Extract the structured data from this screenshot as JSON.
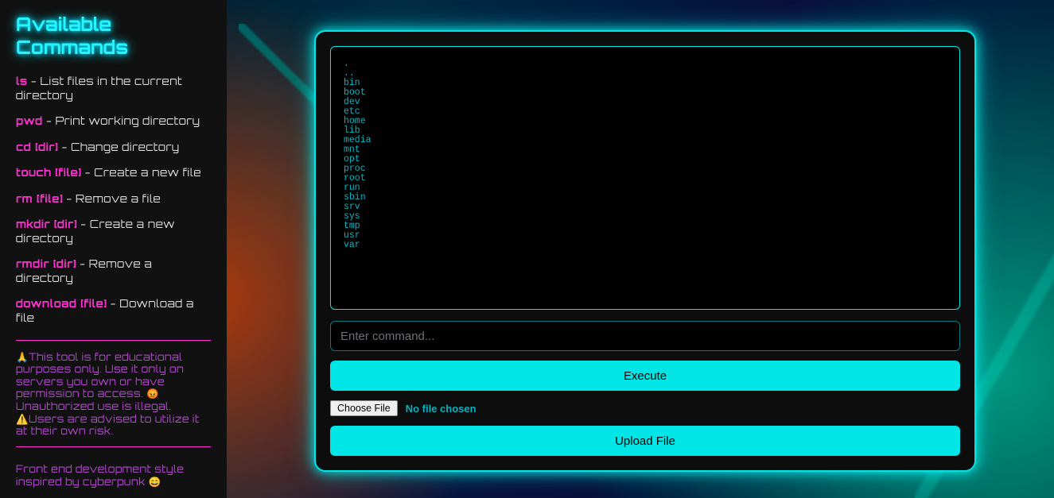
{
  "sidebar": {
    "title": "Available Commands",
    "commands": [
      {
        "cmd": "ls",
        "desc": " - List files in the current directory"
      },
      {
        "cmd": "pwd",
        "desc": " - Print working directory"
      },
      {
        "cmd": "cd [dir]",
        "desc": " - Change directory"
      },
      {
        "cmd": "touch [file]",
        "desc": " - Create a new file"
      },
      {
        "cmd": "rm [file]",
        "desc": " - Remove a file"
      },
      {
        "cmd": "mkdir [dir]",
        "desc": " - Create a new directory"
      },
      {
        "cmd": "rmdir [dir]",
        "desc": " - Remove a directory"
      },
      {
        "cmd": "download [file]",
        "desc": " - Download a file"
      }
    ],
    "disclaimer": "🙏This tool is for educational purposes only. Use it only on servers you own or have permission to access. 😡Unauthorized use is illegal. ⚠️Users are advised to utilize it at their own risk.",
    "credit": "Front end development style inspired by cyberpunk 😄"
  },
  "terminal": {
    "output": ".\n..\nbin\nboot\ndev\netc\nhome\nlib\nmedia\nmnt\nopt\nproc\nroot\nrun\nsbin\nsrv\nsys\ntmp\nusr\nvar"
  },
  "input": {
    "placeholder": "Enter command...",
    "value": ""
  },
  "buttons": {
    "execute": "Execute",
    "choose_file": "Choose File",
    "file_status": "No file chosen",
    "upload": "Upload File"
  }
}
